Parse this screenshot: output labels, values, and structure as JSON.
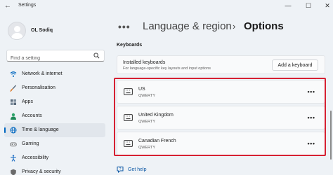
{
  "window": {
    "title": "Settings",
    "back_glyph": "←",
    "minimize_glyph": "—",
    "maximize_glyph": "☐",
    "close_glyph": "✕"
  },
  "user": {
    "name": "OL Sodiq"
  },
  "search": {
    "placeholder": "Find a setting",
    "icon": "search-icon"
  },
  "sidebar": {
    "items": [
      {
        "label": "Network & internet",
        "icon": "wifi-icon",
        "color": "#0067c0"
      },
      {
        "label": "Personalisation",
        "icon": "brush-icon",
        "color": "#d97a2b"
      },
      {
        "label": "Apps",
        "icon": "apps-icon",
        "color": "#5a6b7c"
      },
      {
        "label": "Accounts",
        "icon": "person-icon",
        "color": "#2ea36a"
      },
      {
        "label": "Time & language",
        "icon": "globe-clock-icon",
        "color": "#0067c0",
        "active": true
      },
      {
        "label": "Gaming",
        "icon": "gamepad-icon",
        "color": "#6b6b6b"
      },
      {
        "label": "Accessibility",
        "icon": "accessibility-icon",
        "color": "#1f6fc4"
      },
      {
        "label": "Privacy & security",
        "icon": "shield-icon",
        "color": "#6b6b6b"
      }
    ]
  },
  "breadcrumb": {
    "overflow": "•••",
    "parent": "Language & region",
    "separator": "›",
    "current": "Options"
  },
  "keyboards": {
    "section_title": "Keyboards",
    "installed_title": "Installed keyboards",
    "installed_subtitle": "For language-specific key layouts and input options",
    "add_button_label": "Add a keyboard",
    "items": [
      {
        "name": "US",
        "layout": "QWERTY",
        "more": "•••"
      },
      {
        "name": "United Kingdom",
        "layout": "QWERTY",
        "more": "•••"
      },
      {
        "name": "Canadian French",
        "layout": "QWERTY",
        "more": "•••"
      }
    ]
  },
  "help": {
    "label": "Get help",
    "icon": "help-icon"
  },
  "colors": {
    "accent": "#0067c0",
    "highlight_border": "#d62032",
    "background": "#eef2f6",
    "card": "#f9fafb"
  }
}
